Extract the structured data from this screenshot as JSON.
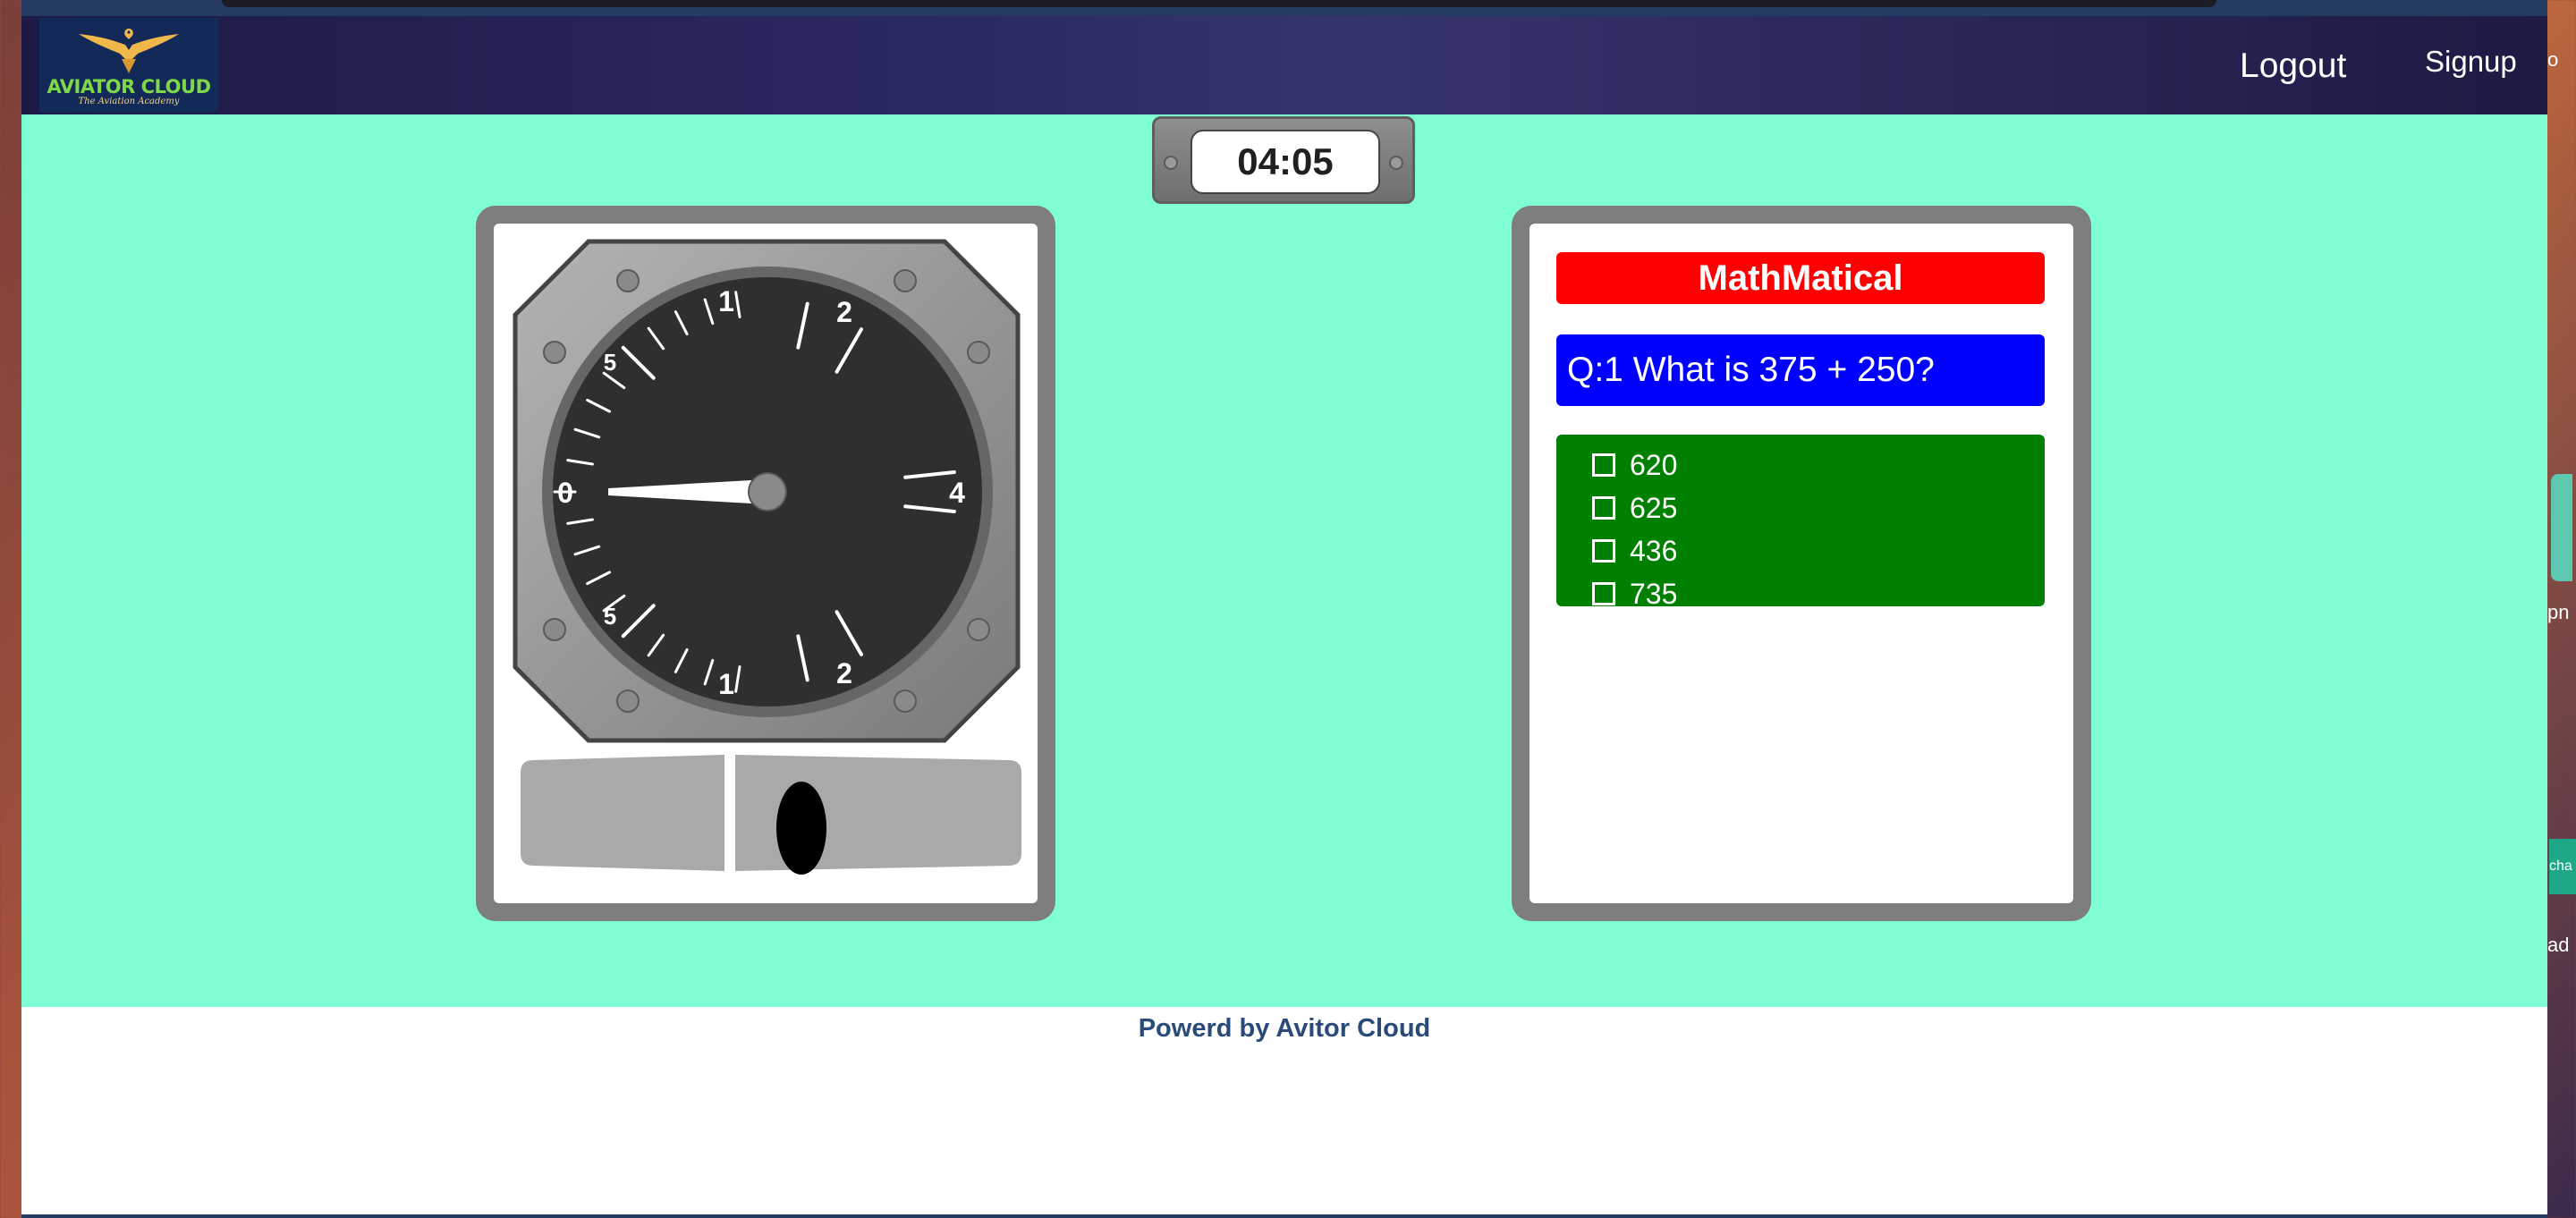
{
  "header": {
    "brand_name": "AVIATOR CLOUD",
    "brand_tagline": "The Aviation Academy",
    "logout_label": "Logout",
    "signup_label": "Signup"
  },
  "timer": {
    "value": "04:05"
  },
  "instrument": {
    "type": "vertical-speed-indicator",
    "scale_labels": [
      "1",
      "2",
      "5",
      "0",
      "4",
      "5",
      "1",
      "2"
    ],
    "needle_value": "0"
  },
  "quiz": {
    "title": "MathMatical",
    "question": "Q:1 What is 375 + 250?",
    "options": [
      {
        "label": "620",
        "checked": false
      },
      {
        "label": "625",
        "checked": false
      },
      {
        "label": "436",
        "checked": false
      },
      {
        "label": "735",
        "checked": false
      }
    ]
  },
  "footer": {
    "text": "Powerd by Avitor Cloud"
  },
  "edge_peek": {
    "top": "o",
    "mid": "pn",
    "low": "cha",
    "bottom": "ad"
  },
  "colors": {
    "stage_bg": "#80ffd4",
    "title_bg": "#ff0000",
    "question_bg": "#0000ff",
    "options_bg": "#008000",
    "panel_frame": "#7e7e7e",
    "brand_green": "#7fd84a"
  }
}
